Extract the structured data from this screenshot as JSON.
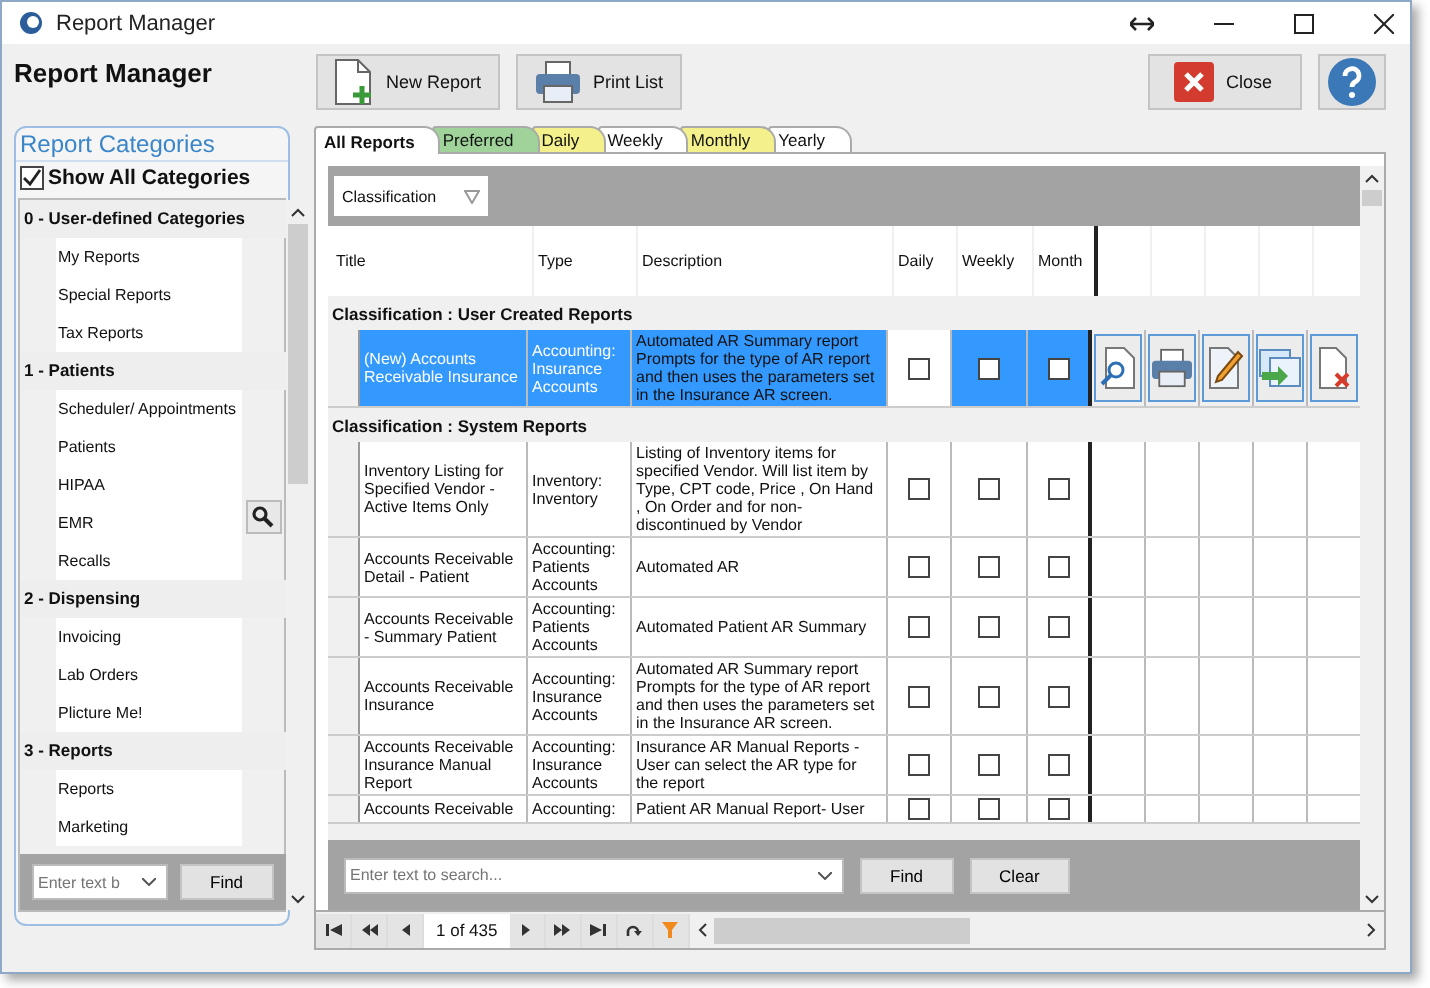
{
  "window": {
    "title": "Report Manager"
  },
  "header": {
    "title": "Report Manager"
  },
  "toolbar": [
    {
      "label": "New Report",
      "kind": "new"
    },
    {
      "label": "Print List",
      "kind": "print"
    }
  ],
  "close_button": {
    "label": "Close"
  },
  "sidebar": {
    "title": "Report Categories",
    "show_all": {
      "label": "Show All Categories",
      "checked": true
    },
    "groups": [
      {
        "label": "0 - User-defined Categories",
        "children": [
          {
            "label": "My Reports"
          },
          {
            "label": "Special Reports"
          },
          {
            "label": "Tax Reports"
          }
        ]
      },
      {
        "label": "1 - Patients",
        "children": [
          {
            "label": "Scheduler/ Appointments"
          },
          {
            "label": "Patients"
          },
          {
            "label": "HIPAA"
          },
          {
            "label": "EMR"
          },
          {
            "label": "Recalls"
          }
        ]
      },
      {
        "label": "2 - Dispensing",
        "children": [
          {
            "label": "Invoicing"
          },
          {
            "label": "Lab Orders"
          },
          {
            "label": "Plicture Me!"
          }
        ]
      },
      {
        "label": "3 - Reports",
        "children": [
          {
            "label": "Reports"
          },
          {
            "label": "Marketing"
          }
        ]
      }
    ],
    "search": {
      "placeholder": "Enter text b"
    },
    "find": "Find"
  },
  "tabs": [
    {
      "label": "All Reports",
      "selected": true,
      "color": "#ffffff"
    },
    {
      "label": "Preferred",
      "selected": false,
      "color": "#9fd39a"
    },
    {
      "label": "Daily",
      "selected": false,
      "color": "#f4f08c"
    },
    {
      "label": "Weekly",
      "selected": false,
      "color": "#ffffff"
    },
    {
      "label": "Monthly",
      "selected": false,
      "color": "#f4f08c"
    },
    {
      "label": "Yearly",
      "selected": false,
      "color": "#ffffff"
    }
  ],
  "group_by": "Classification",
  "columns": [
    "Title",
    "Type",
    "Description",
    "Daily",
    "Weekly",
    "Month"
  ],
  "groups": [
    {
      "label": "Classification : User Created Reports",
      "rows": [
        {
          "title": "(New) Accounts Receivable Insurance",
          "type": "Accounting: Insurance Accounts",
          "description": "Automated AR Summary report Prompts for the type of AR report and then uses the parameters set in the Insurance AR screen.",
          "selected": true,
          "daily": false,
          "weekly": false,
          "monthly": false
        }
      ]
    },
    {
      "label": "Classification : System Reports",
      "rows": [
        {
          "title": "Inventory Listing for Specified Vendor - Active Items Only",
          "type": "Inventory: Inventory",
          "description": "Listing of Inventory items for specified Vendor. Will list item by Type, CPT code, Price , On Hand , On Order and for non-discontinued by Vendor",
          "selected": false,
          "daily": false,
          "weekly": false,
          "monthly": false
        },
        {
          "title": "Accounts Receivable Detail - Patient",
          "type": "Accounting: Patients Accounts",
          "description": "Automated AR",
          "selected": false,
          "daily": false,
          "weekly": false,
          "monthly": false
        },
        {
          "title": "Accounts Receivable - Summary Patient",
          "type": "Accounting: Patients Accounts",
          "description": "Automated Patient AR Summary",
          "selected": false,
          "daily": false,
          "weekly": false,
          "monthly": false
        },
        {
          "title": "Accounts Receivable Insurance",
          "type": "Accounting: Insurance Accounts",
          "description": "Automated AR Summary report Prompts for the type of AR report and then uses the parameters set in the Insurance AR screen.",
          "selected": false,
          "daily": false,
          "weekly": false,
          "monthly": false
        },
        {
          "title": "Accounts Receivable Insurance  Manual Report",
          "type": "Accounting: Insurance Accounts",
          "description": "Insurance AR  Manual Reports - User can select the AR type for the report",
          "selected": false,
          "daily": false,
          "weekly": false,
          "monthly": false
        },
        {
          "title": "Accounts Receivable",
          "type": "Accounting:",
          "description": "Patient AR Manual Report- User",
          "selected": false,
          "daily": false,
          "weekly": false,
          "monthly": false
        }
      ]
    }
  ],
  "search": {
    "placeholder": "Enter text to search...",
    "find": "Find",
    "clear": "Clear"
  },
  "pager": {
    "page": "1 of 435"
  }
}
